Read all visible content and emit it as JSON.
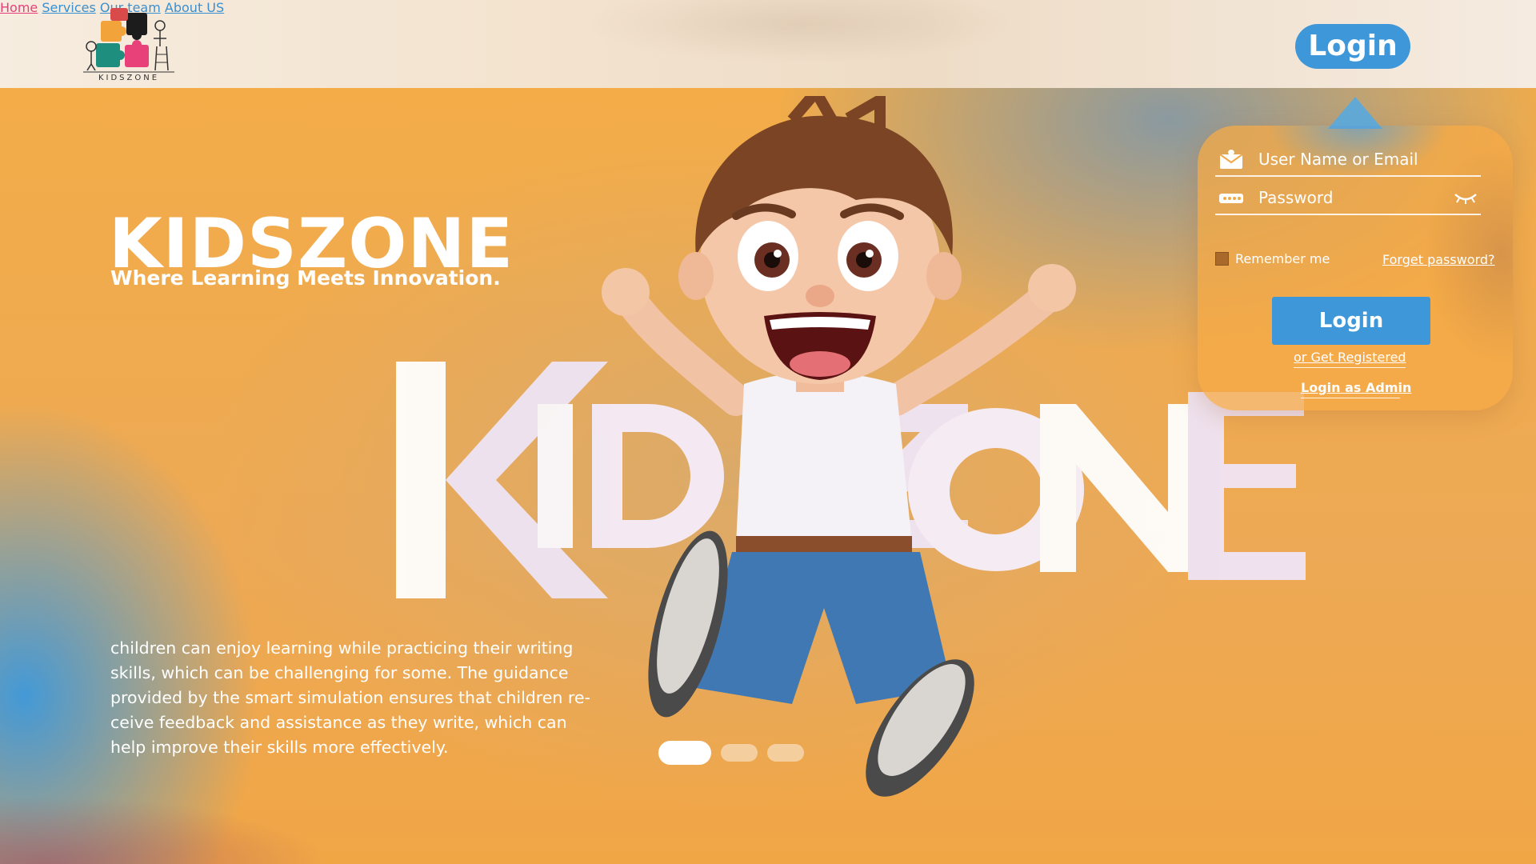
{
  "brand": {
    "logo_text": "KIDSZONE"
  },
  "nav": {
    "items": [
      {
        "label": "Home",
        "color": "#e83e7a"
      },
      {
        "label": "Services",
        "color": "#3a8fd0"
      },
      {
        "label": "Our team",
        "color": "#3a8fd0"
      },
      {
        "label": "About US",
        "color": "#3a8fd0"
      }
    ],
    "login_label": "Login"
  },
  "hero": {
    "title": "KIDSZONE",
    "subtitle": "Where Learning Meets Innovation.",
    "description": "children can enjoy learning while practicing their writing skills, which can be challenging for some. The guidance provided by the smart simulation ensures that children re-ceive feedback and assistance as they write, which can help improve their skills more effectively.",
    "wordmark": "KIDSZONE",
    "slides": {
      "count": 3,
      "active": 1
    }
  },
  "login_panel": {
    "username_placeholder": "User Name or Email",
    "password_placeholder": "Password",
    "remember_label": "Remember me",
    "forgot_label": "Forget password?",
    "login_label": "Login",
    "register_label": "or Get Registered",
    "admin_label": "Login as Admin"
  },
  "colors": {
    "accent_blue": "#3d97d9",
    "accent_pink": "#e83e7a",
    "hero_orange": "#f1a846"
  }
}
